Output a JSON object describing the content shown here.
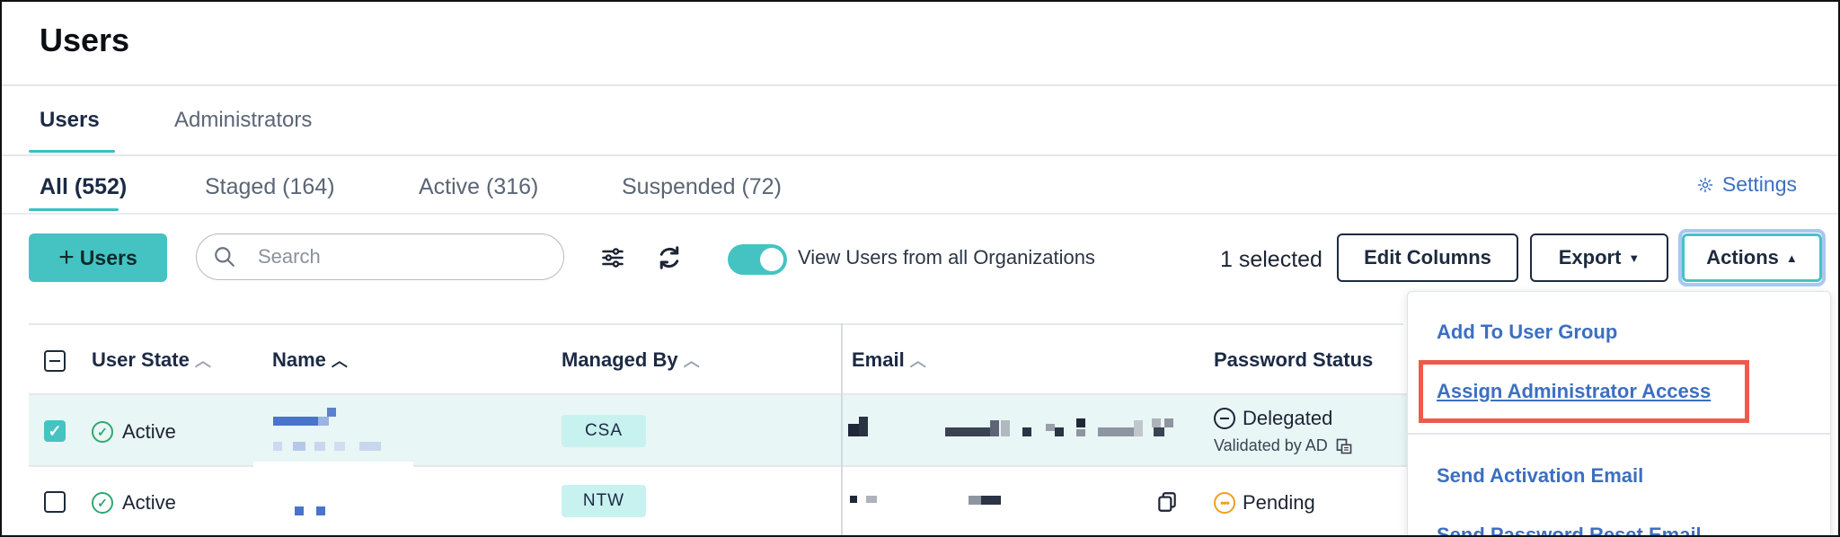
{
  "page_title": "Users",
  "primary_tabs": [
    {
      "label": "Users",
      "active": true
    },
    {
      "label": "Administrators",
      "active": false
    }
  ],
  "status_tabs": [
    {
      "label": "All (552)",
      "active": true
    },
    {
      "label": "Staged (164)",
      "active": false
    },
    {
      "label": "Active (316)",
      "active": false
    },
    {
      "label": "Suspended (72)",
      "active": false
    }
  ],
  "settings_label": "Settings",
  "toolbar": {
    "add_users_label": "Users",
    "search_placeholder": "Search",
    "toggle_label": "View Users from all Organizations",
    "toggle_on": true,
    "selected_text": "1 selected",
    "edit_columns_label": "Edit Columns",
    "export_label": "Export",
    "actions_label": "Actions"
  },
  "table": {
    "headers": {
      "user_state": "User State",
      "name": "Name",
      "managed_by": "Managed By",
      "email": "Email",
      "password_status": "Password Status"
    },
    "rows": [
      {
        "selected": true,
        "state": "Active",
        "managed_by": "CSA",
        "password_status": "Delegated",
        "password_sub": "Validated by AD"
      },
      {
        "selected": false,
        "state": "Active",
        "managed_by": "NTW",
        "password_status": "Pending",
        "password_sub": ""
      }
    ]
  },
  "actions_menu": {
    "items": [
      "Add To User Group",
      "Assign Administrator Access",
      "Send Activation Email",
      "Send Password Reset Email"
    ],
    "highlighted_index": 1
  },
  "colors": {
    "accent": "#45c3c3",
    "link": "#3d6fc0",
    "highlight_box": "#ef5a4d",
    "selected_row": "#e8f6f5"
  }
}
